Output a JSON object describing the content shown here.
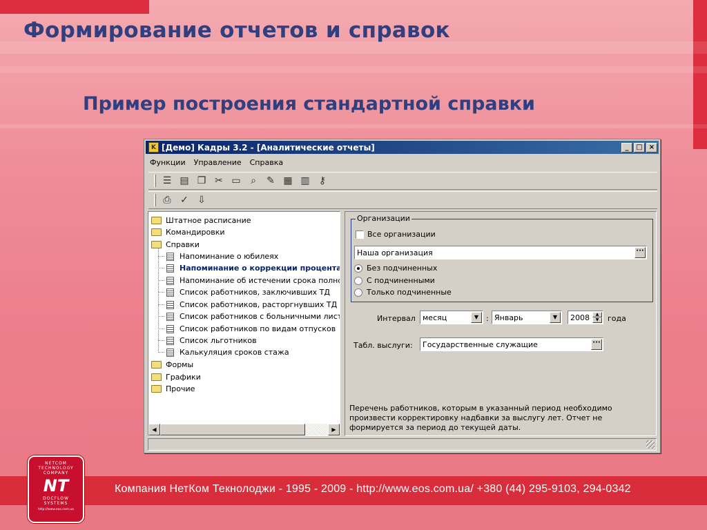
{
  "slide": {
    "title": "Формирование отчетов и справок",
    "subtitle": "Пример построения стандартной справки",
    "footer": "Компания НетКом Текнолоджи - 1995 - 2009 - http://www.eos.com.ua/ +380 (44) 295-9103, 294-0342"
  },
  "logo": {
    "line1": "NETCOM",
    "line2": "TECHNOLOGY",
    "line3": "COMPANY",
    "mark": "NT",
    "line4": "DOCFLOW",
    "line5": "SYSTEMS",
    "url": "http://www.eos.com.ua"
  },
  "window": {
    "title": "[Демо] Кадры 3.2 - [Аналитические отчеты]",
    "icon_label": "K",
    "controls": {
      "minimize": "_",
      "maximize": "□",
      "close": "×"
    }
  },
  "menu": [
    "Функции",
    "Управление",
    "Справка"
  ],
  "toolbar1_icons": [
    "list-icon",
    "card-icon",
    "copy-icon",
    "scissors-icon",
    "briefcase-icon",
    "search-icon",
    "edit-icon",
    "table-icon",
    "book-icon",
    "key-icon"
  ],
  "toolbar1_glyphs": [
    "☰",
    "▤",
    "❐",
    "✂",
    "▭",
    "⌕",
    "✎",
    "▦",
    "▥",
    "⚷"
  ],
  "toolbar2_icons": [
    "print-preview-icon",
    "spell-icon",
    "export-icon"
  ],
  "toolbar2_glyphs": [
    "⎙",
    "✓",
    "⇩"
  ],
  "tree": {
    "items": [
      {
        "label": "Штатное расписание",
        "type": "folder",
        "level": 0
      },
      {
        "label": "Командировки",
        "type": "folder",
        "level": 0
      },
      {
        "label": "Справки",
        "type": "folder-open",
        "level": 0
      },
      {
        "label": "Напоминание о юбилеях",
        "type": "doc",
        "level": 1
      },
      {
        "label": "Напоминание о коррекции процента",
        "type": "doc",
        "level": 1,
        "selected": true
      },
      {
        "label": "Напоминание об истечении срока полномо",
        "type": "doc",
        "level": 1
      },
      {
        "label": "Список работников, заключивших ТД",
        "type": "doc",
        "level": 1
      },
      {
        "label": "Список работников, расторгнувших ТД",
        "type": "doc",
        "level": 1
      },
      {
        "label": "Список работников с больничными листа",
        "type": "doc",
        "level": 1
      },
      {
        "label": "Список работников по видам отпусков",
        "type": "doc",
        "level": 1
      },
      {
        "label": "Список льготников",
        "type": "doc",
        "level": 1
      },
      {
        "label": "Калькуляция сроков стажа",
        "type": "doc",
        "level": 1
      },
      {
        "label": "Формы",
        "type": "folder",
        "level": 0
      },
      {
        "label": "Графики",
        "type": "folder",
        "level": 0
      },
      {
        "label": "Прочие",
        "type": "folder",
        "level": 0
      }
    ],
    "scroll_left": "◀",
    "scroll_right": "▶"
  },
  "org_group": {
    "legend": "Организации",
    "all_orgs_label": "Все организации",
    "org_value": "Наша организация",
    "radios": [
      {
        "label": "Без подчиненных",
        "checked": true
      },
      {
        "label": "С подчиненными",
        "checked": false
      },
      {
        "label": "Только подчиненные",
        "checked": false
      }
    ]
  },
  "interval": {
    "label": "Интервал",
    "period": "месяц",
    "separator": ":",
    "month": "Январь",
    "year": "2008",
    "year_suffix": "года"
  },
  "service_table": {
    "label": "Табл. выслуги:",
    "value": "Государственные служащие"
  },
  "buttons": {
    "dots": "···",
    "drop": "▼",
    "up": "▲",
    "down": "▼"
  },
  "description": "Перечень работников, которым в указанный период необходимо произвести корректировку надбавки за выслугу лет. Отчет не формируется за период до текущей даты.",
  "colors": {
    "title_blue": "#2f3f7f",
    "accent_red": "#da2d3b",
    "titlebar": "#0a246a"
  }
}
